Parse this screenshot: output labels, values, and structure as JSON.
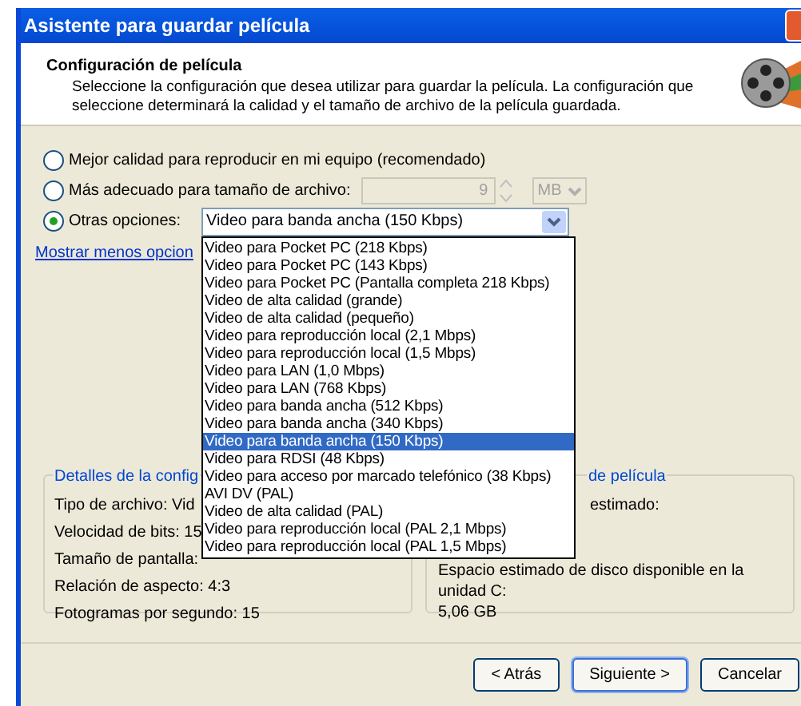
{
  "window": {
    "title": "Asistente para guardar película"
  },
  "header": {
    "title": "Configuración de película",
    "description": "Seleccione la configuración que desea utilizar para guardar la película. La configuración que seleccione determinará la calidad y el tamaño de archivo de la película guardada."
  },
  "options": [
    {
      "kind": "plain",
      "label": "Mejor calidad para reproducir en mi equipo (recomendado)",
      "selected": false
    },
    {
      "kind": "size",
      "label": "Más adecuado para tamaño de archivo:",
      "selected": false,
      "size_value": "9",
      "unit": "MB",
      "disabled": true
    },
    {
      "kind": "preset",
      "label": "Otras opciones:",
      "selected": true,
      "value": "Video para banda ancha (150 Kbps)"
    }
  ],
  "link": "Mostrar menos opcion",
  "dropdown": {
    "expanded": true,
    "items": [
      {
        "label": "Video para Pocket PC (218 Kbps)",
        "selected": false
      },
      {
        "label": "Video para Pocket PC (143 Kbps)",
        "selected": false
      },
      {
        "label": "Video para Pocket PC (Pantalla completa 218 Kbps)",
        "selected": false
      },
      {
        "label": "Video de alta calidad (grande)",
        "selected": false
      },
      {
        "label": "Video de alta calidad (pequeño)",
        "selected": false
      },
      {
        "label": "Video para reproducción local (2,1 Mbps)",
        "selected": false
      },
      {
        "label": "Video para reproducción local (1,5 Mbps)",
        "selected": false
      },
      {
        "label": "Video para LAN (1,0 Mbps)",
        "selected": false
      },
      {
        "label": "Video para LAN (768 Kbps)",
        "selected": false
      },
      {
        "label": "Video para banda ancha (512 Kbps)",
        "selected": false
      },
      {
        "label": "Video para banda ancha (340 Kbps)",
        "selected": false
      },
      {
        "label": "Video para banda ancha (150 Kbps)",
        "selected": true
      },
      {
        "label": "Video para RDSI (48 Kbps)",
        "selected": false
      },
      {
        "label": "Video para acceso por marcado telefónico (38 Kbps)",
        "selected": false
      },
      {
        "label": "AVI DV (PAL)",
        "selected": false
      },
      {
        "label": "Video de alta calidad (PAL)",
        "selected": false
      },
      {
        "label": "Video para reproducción local (PAL 2,1 Mbps)",
        "selected": false
      },
      {
        "label": "Video para reproducción local (PAL 1,5 Mbps)",
        "selected": false
      }
    ]
  },
  "details": {
    "title": "Detalles de la config",
    "lines": [
      "Tipo de archivo: Vid",
      "Velocidad de bits: 15",
      "Tamaño de pantalla:",
      "Relación de aspecto: 4:3",
      "Fotogramas por segundo: 15"
    ]
  },
  "estimate": {
    "title": "de película",
    "partial_line": "estimado:",
    "lines": [
      "Espacio estimado de disco disponible en la unidad C:",
      "5,06 GB"
    ]
  },
  "buttons": [
    {
      "label": "< Atrás",
      "default": false
    },
    {
      "label": "Siguiente >",
      "default": true
    },
    {
      "label": "Cancelar",
      "default": false
    }
  ]
}
